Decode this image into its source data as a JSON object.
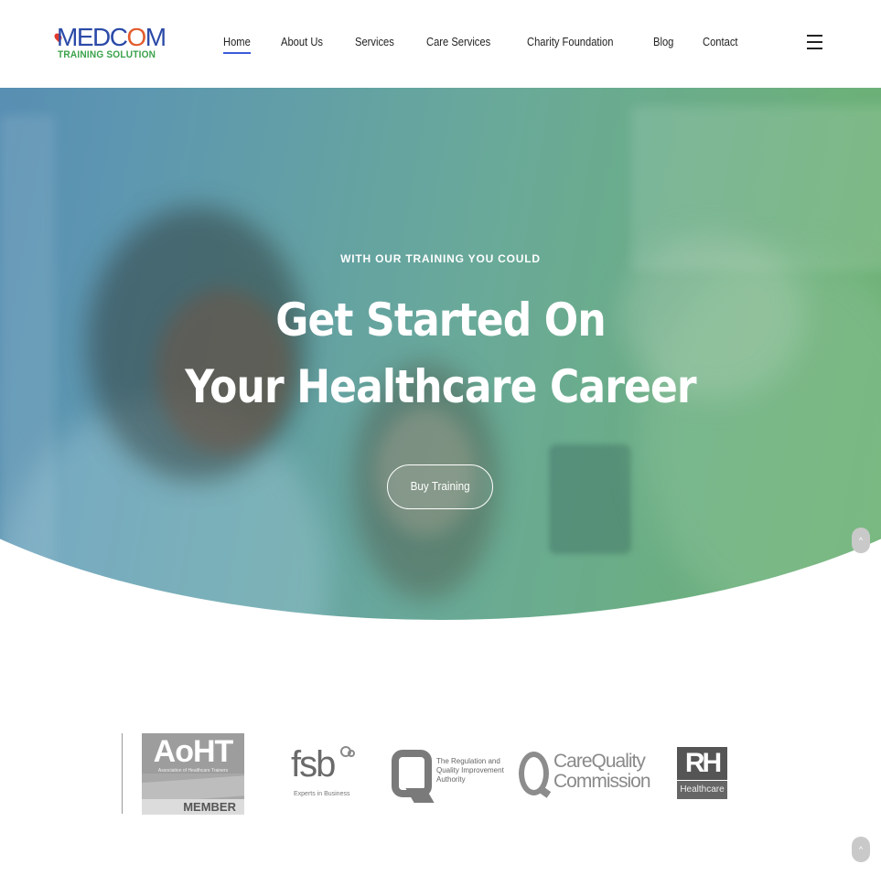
{
  "logo": {
    "main_part1": "MEDC",
    "main_part2": "O",
    "main_part3": "M",
    "sub": "TRAINING SOLUTION"
  },
  "nav": {
    "items": [
      {
        "label": "Home",
        "active": true
      },
      {
        "label": "About Us"
      },
      {
        "label": "Services"
      },
      {
        "label": "Care Services"
      },
      {
        "label": "Charity Foundation"
      },
      {
        "label": "Blog"
      },
      {
        "label": "Contact"
      }
    ]
  },
  "hero": {
    "kicker": "WITH OUR TRAINING YOU COULD",
    "title_line1": "Get Started On",
    "title_line2": "Your Healthcare Career",
    "button_label": "Buy Training"
  },
  "partners": {
    "aoht": {
      "title": "AoHT",
      "subtitle": "Association of Healthcare Trainers",
      "member": "MEMBER"
    },
    "fsb": {
      "name": "fsb",
      "tagline": "Experts in Business"
    },
    "rqia": {
      "line1": "The Regulation and",
      "line2": "Quality Improvement",
      "line3": "Authority"
    },
    "cqc": {
      "line1": "CareQuality",
      "line2": "Commission"
    },
    "rh": {
      "mark": "RH",
      "label": "Healthcare"
    }
  },
  "icons": {
    "menu": "hamburger-icon",
    "scroll_top": "chevron-up-icon"
  },
  "colors": {
    "brand_blue": "#2b4aa8",
    "brand_orange": "#e35b2c",
    "brand_green": "#3aa24a",
    "nav_active_underline": "#3b5bdb",
    "hero_gradient_start": "#4f7fb8",
    "hero_gradient_end": "#6db264"
  }
}
